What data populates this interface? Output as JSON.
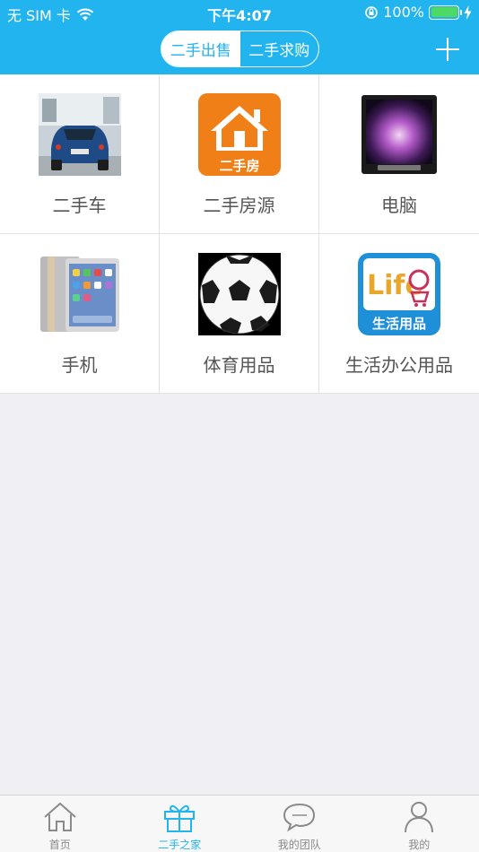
{
  "status_bar": {
    "carrier": "无 SIM 卡",
    "time": "下午4:07",
    "battery": "100%",
    "icons": [
      "wifi-icon",
      "rotation-lock-icon",
      "battery-icon",
      "charging-bolt-icon"
    ]
  },
  "header": {
    "segments": [
      "二手出售",
      "二手求购"
    ],
    "selected_segment": "二手出售",
    "add_icon": "plus-icon"
  },
  "categories": [
    {
      "label": "二手车",
      "icon": "car-thumbnail"
    },
    {
      "label": "二手房源",
      "icon": "house-thumbnail",
      "image_text": "二手房"
    },
    {
      "label": "电脑",
      "icon": "computer-thumbnail"
    },
    {
      "label": "手机",
      "icon": "phone-tablet-thumbnail"
    },
    {
      "label": "体育用品",
      "icon": "soccer-ball-thumbnail"
    },
    {
      "label": "生活办公用品",
      "icon": "life-goods-thumbnail",
      "image_text": "生活用品",
      "logo_text": "Life"
    }
  ],
  "tabbar": {
    "items": [
      {
        "label": "首页",
        "icon": "home-icon"
      },
      {
        "label": "二手之家",
        "icon": "gift-icon"
      },
      {
        "label": "我的团队",
        "icon": "chat-bubbles-icon"
      },
      {
        "label": "我的",
        "icon": "person-icon"
      }
    ],
    "active": "二手之家"
  },
  "colors": {
    "brand": "#21b4ee",
    "background": "#efeff4",
    "label_text": "#555555"
  }
}
